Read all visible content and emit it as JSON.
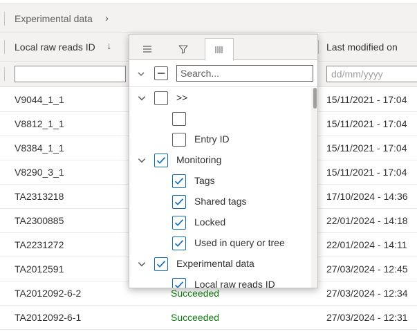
{
  "grid": {
    "group_label": "Experimental data",
    "columns": {
      "col1": "Local raw reads ID",
      "col3": "Last modified on"
    },
    "filter": {
      "date_placeholder": "dd/mm/yyyy"
    },
    "rows": [
      {
        "id": "V9044_1_1",
        "status": "",
        "modified": "15/11/2021 - 17:04"
      },
      {
        "id": "V8812_1_1",
        "status": "",
        "modified": "15/11/2021 - 17:04"
      },
      {
        "id": "V8384_1_1",
        "status": "",
        "modified": "15/11/2021 - 17:04"
      },
      {
        "id": "V8290_3_1",
        "status": "",
        "modified": "15/11/2021 - 17:04"
      },
      {
        "id": "TA2313218",
        "status": "",
        "modified": "17/10/2024 - 14:36"
      },
      {
        "id": "TA2300885",
        "status": "",
        "modified": "22/01/2024 - 14:18"
      },
      {
        "id": "TA2231272",
        "status": "",
        "modified": "22/01/2024 - 14:11"
      },
      {
        "id": "TA2012591",
        "status": "",
        "modified": "27/03/2024 - 12:45"
      },
      {
        "id": "TA2012092-6-2",
        "status": "Succeeded",
        "modified": "27/03/2024 - 12:34"
      },
      {
        "id": "TA2012092-6-1",
        "status": "Succeeded",
        "modified": "27/03/2024 - 12:31"
      }
    ]
  },
  "column_menu": {
    "tabs": [
      "general-menu-icon",
      "filter-icon",
      "columns-icon"
    ],
    "active_tab": 2,
    "search_placeholder": "Search...",
    "items": [
      {
        "label": ">>",
        "checked": false,
        "group": true
      },
      {
        "label": "",
        "checked": false,
        "group": false
      },
      {
        "label": "Entry ID",
        "checked": false,
        "group": false
      },
      {
        "label": "Monitoring",
        "checked": true,
        "group": true
      },
      {
        "label": "Tags",
        "checked": true,
        "group": false
      },
      {
        "label": "Shared tags",
        "checked": true,
        "group": false
      },
      {
        "label": "Locked",
        "checked": true,
        "group": false
      },
      {
        "label": "Used in query or tree",
        "checked": true,
        "group": false
      },
      {
        "label": "Experimental data",
        "checked": true,
        "group": true
      },
      {
        "label": "Local raw reads ID",
        "checked": true,
        "group": false
      }
    ]
  },
  "colors": {
    "accent": "#0f6cbd",
    "success": "#107c10"
  }
}
